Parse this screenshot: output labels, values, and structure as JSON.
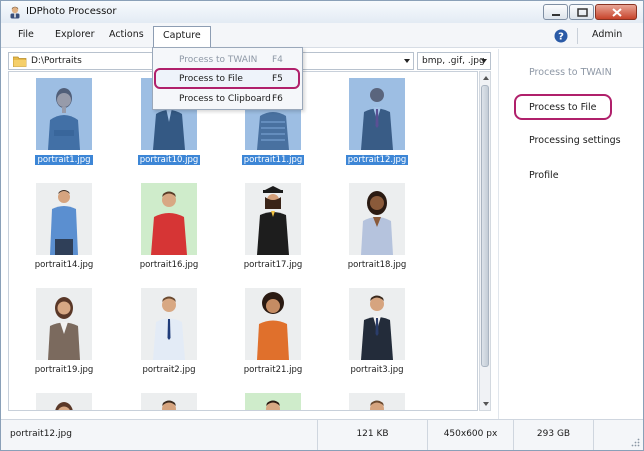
{
  "window": {
    "title": "IDPhoto Processor"
  },
  "menu": {
    "items": [
      "File",
      "Explorer",
      "Actions",
      "Capture"
    ],
    "admin": "Admin"
  },
  "capture_menu": [
    {
      "label": "Process to TWAIN",
      "shortcut": "F4",
      "disabled": true
    },
    {
      "label": "Process to File",
      "shortcut": "F5",
      "active": true
    },
    {
      "label": "Process to Clipboard",
      "shortcut": "F6"
    }
  ],
  "path": {
    "value": "D:\\Portraits",
    "filter": "bmp, .gif, .jpg"
  },
  "thumbnails": [
    {
      "name": "portrait1.jpg",
      "selected": true
    },
    {
      "name": "portrait10.jpg",
      "selected": true
    },
    {
      "name": "portrait11.jpg",
      "selected": true
    },
    {
      "name": "portrait12.jpg",
      "selected": true
    },
    {
      "name": "portrait14.jpg"
    },
    {
      "name": "portrait16.jpg"
    },
    {
      "name": "portrait17.jpg"
    },
    {
      "name": "portrait18.jpg"
    },
    {
      "name": "portrait19.jpg"
    },
    {
      "name": "portrait2.jpg"
    },
    {
      "name": "portrait21.jpg"
    },
    {
      "name": "portrait3.jpg"
    }
  ],
  "right_panel": {
    "process_twain": "Process to TWAIN",
    "process_file": "Process to File",
    "processing_settings": "Processing settings",
    "profile": "Profile"
  },
  "status": {
    "file": "portrait12.jpg",
    "size": "121 KB",
    "dimensions": "450x600 px",
    "free": "293 GB"
  },
  "colors": {
    "accent": "#b0206b",
    "selection": "#3d86d6"
  }
}
